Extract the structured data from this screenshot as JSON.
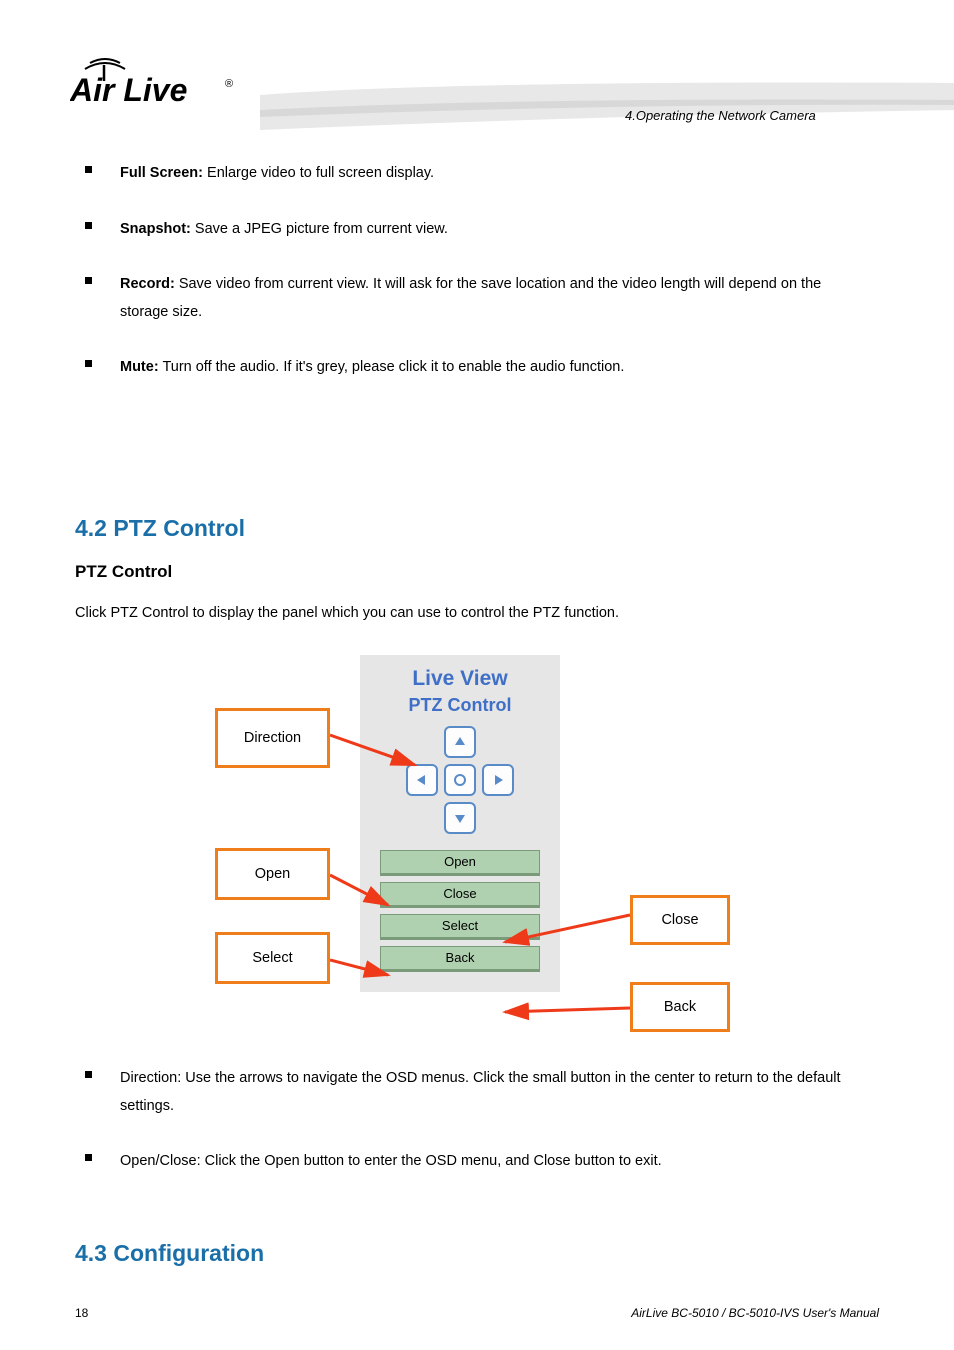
{
  "chapter_line": "4.Operating the Network Camera",
  "logo_text": "AirLive",
  "bullets_top": [
    {
      "label": "Full Screen:",
      "desc": " Enlarge video to full screen display."
    },
    {
      "label": "Snapshot:",
      "desc": " Save a JPEG picture from current view."
    },
    {
      "label": "Record:",
      "desc": " Save video from current view. It will ask for the save location and the video length will depend on the storage size."
    },
    {
      "label": "Mute:",
      "desc": " Turn off the audio. If it's grey, please click it to enable the audio function."
    }
  ],
  "section": {
    "num": "4.2 ",
    "title": "PTZ Control"
  },
  "section_para": "Click PTZ Control to display the panel which you can use to control the PTZ function.",
  "ptz": {
    "title": "Live View",
    "sub": "PTZ Control",
    "btn_open": "Open",
    "btn_close": "Close",
    "btn_select": "Select",
    "btn_back": "Back"
  },
  "callouts": {
    "c1": "Direction",
    "c2": "Open",
    "c3": "Select",
    "c4": "Close",
    "c5": "Back"
  },
  "bullets_bottom": [
    {
      "label": "Direction:",
      "desc": " Use the arrows to navigate the OSD menus. Click the small button in the center to return to the default settings."
    },
    {
      "label": "Open/Close:",
      "desc": " Click the Open button to enter the OSD menu, and Close button to exit."
    }
  ],
  "section2": {
    "num": "4.3 ",
    "title": "Configuration"
  },
  "footer": {
    "page": "18",
    "manual": "AirLive BC-5010 / BC-5010-IVS User's Manual"
  }
}
